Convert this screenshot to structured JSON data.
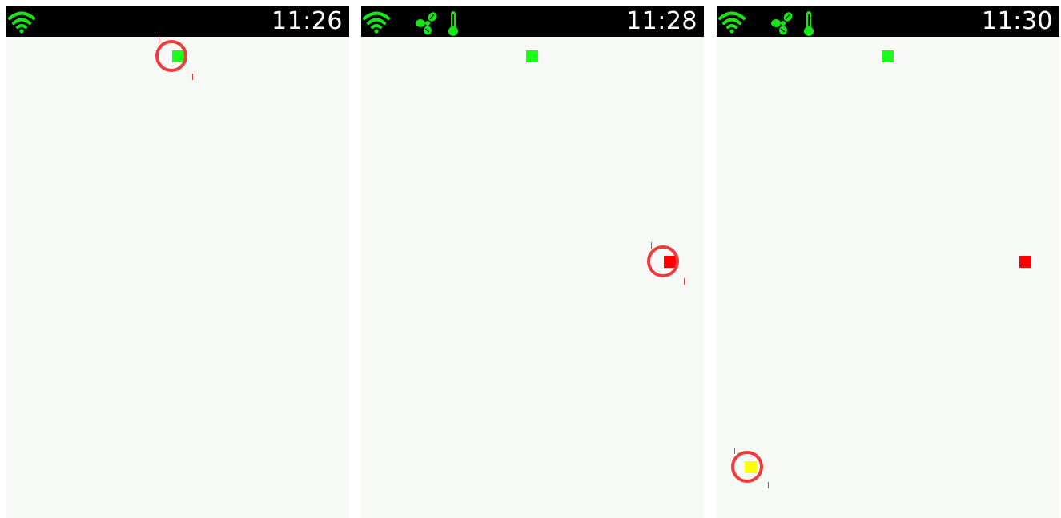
{
  "colors": {
    "status_bar": "#000000",
    "screen_background": "#f6f9f6",
    "status_icon": "#16e516",
    "clock_text": "#ffffff",
    "highlight_ring": "#ef3b3b",
    "marker_green": "#1aff1a",
    "marker_red": "#ff0000",
    "marker_yellow": "#ffff00"
  },
  "screens": [
    {
      "clock": "11:26",
      "status_icons": [
        "wifi-icon"
      ],
      "markers": [
        "green"
      ],
      "highlighted_marker": "green"
    },
    {
      "clock": "11:28",
      "status_icons": [
        "wifi-icon",
        "fan-icon",
        "thermometer-icon"
      ],
      "markers": [
        "green",
        "red"
      ],
      "highlighted_marker": "red"
    },
    {
      "clock": "11:30",
      "status_icons": [
        "wifi-icon",
        "fan-icon",
        "thermometer-icon"
      ],
      "markers": [
        "green",
        "red",
        "yellow"
      ],
      "highlighted_marker": "yellow"
    }
  ]
}
